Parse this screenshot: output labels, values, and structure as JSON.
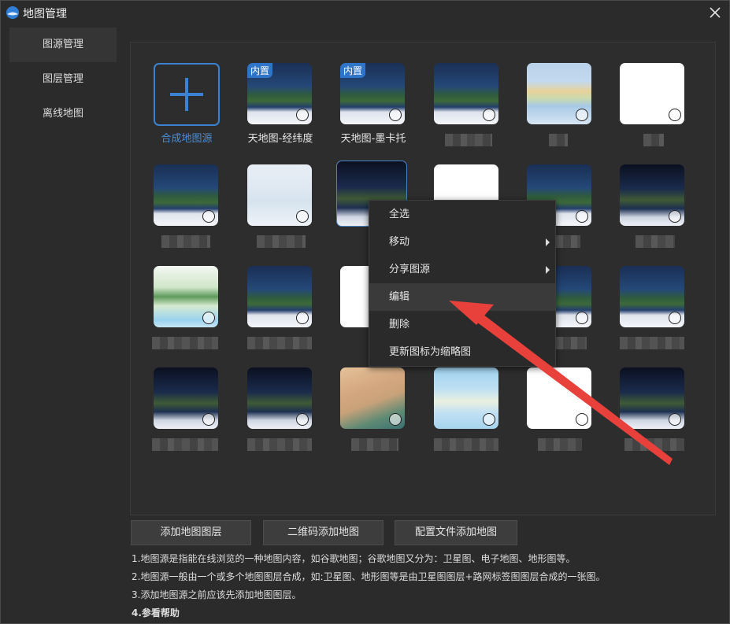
{
  "window": {
    "title": "地图管理"
  },
  "sidebar": {
    "items": [
      {
        "label": "图源管理"
      },
      {
        "label": "图层管理"
      },
      {
        "label": "离线地图"
      }
    ]
  },
  "grid": {
    "add_tile_label": "合成地图源",
    "builtin_badge": "内置",
    "tiles": [
      {
        "label": "天地图-经纬度"
      },
      {
        "label": "天地图-墨卡托"
      }
    ]
  },
  "context_menu": {
    "items": [
      {
        "label": "全选"
      },
      {
        "label": "移动"
      },
      {
        "label": "分享图源"
      },
      {
        "label": "编辑"
      },
      {
        "label": "删除"
      },
      {
        "label": "更新图标为缩略图"
      }
    ]
  },
  "buttons": {
    "add_layer": "添加地图图层",
    "qr_add": "二维码添加地图",
    "config_add": "配置文件添加地图"
  },
  "notes": {
    "line1": "1.地图源是指能在线浏览的一种地图内容，如谷歌地图；谷歌地图又分为：卫星图、电子地图、地形图等。",
    "line2": "2.地图源一般由一个或多个地图图层合成，如:卫星图、地形图等是由卫星图图层+路网标签图图层合成的一张图。",
    "line3": "3.添加地图源之前应该先添加地图图层。",
    "line4": "4.参看帮助"
  },
  "colors": {
    "accent": "#3c82d0",
    "annotation_arrow": "#e8413b"
  }
}
